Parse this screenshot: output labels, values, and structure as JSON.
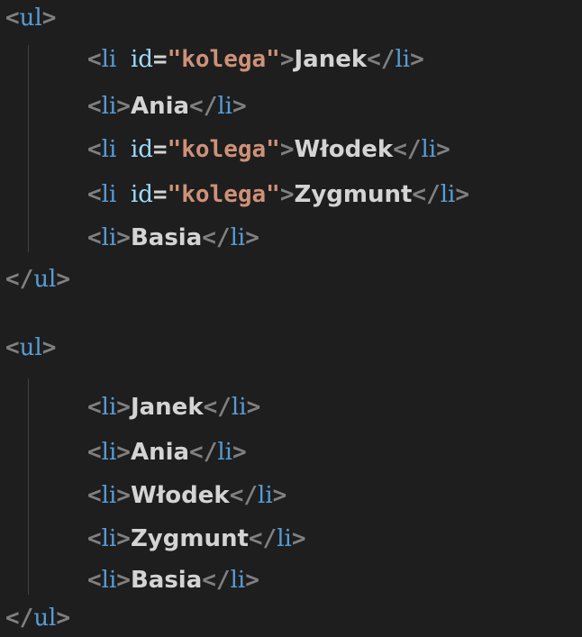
{
  "editor": {
    "colors": {
      "background": "#1e1e1e",
      "bracket": "#808080",
      "tag": "#569cd6",
      "attribute": "#9cdcfe",
      "string": "#ce9178",
      "text": "#d4d4d4"
    },
    "tokens": {
      "lt": "<",
      "gt": ">",
      "close_lt": "</",
      "ul": "ul",
      "li": "li",
      "attr_id": "id",
      "eq": "=",
      "kolega": "\"kolega\""
    },
    "block1": {
      "items": [
        "Janek",
        "Ania",
        "Włodek",
        "Zygmunt",
        "Basia"
      ]
    },
    "block2": {
      "items": [
        "Janek",
        "Ania",
        "Włodek",
        "Zygmunt",
        "Basia"
      ]
    }
  }
}
